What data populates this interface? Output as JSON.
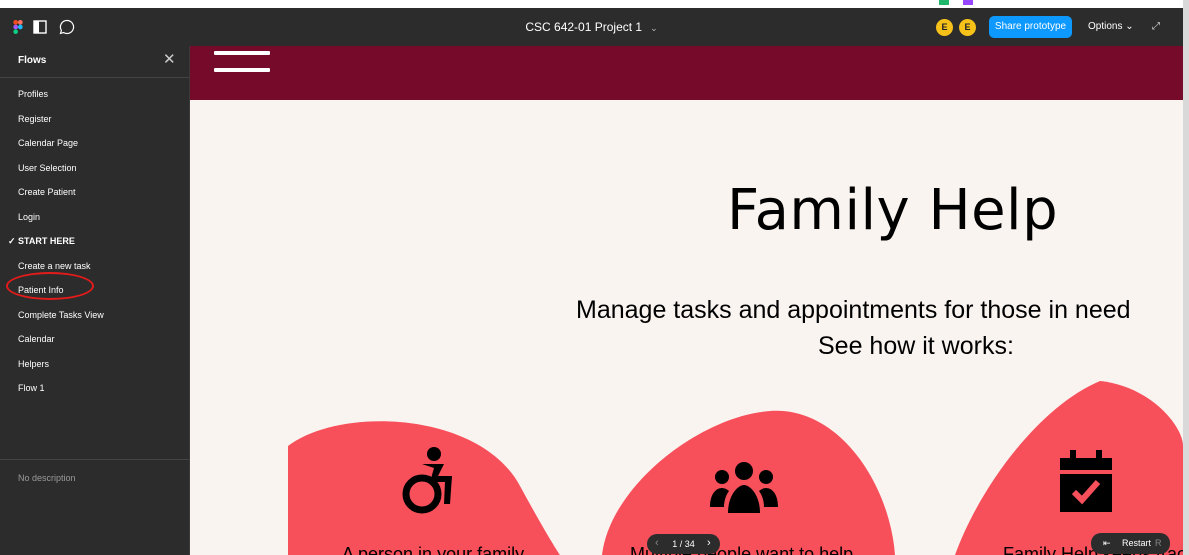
{
  "topbar": {
    "document_title": "CSC 642-01 Project 1",
    "title_chevron": "⌄",
    "avatars": [
      {
        "initial": "E",
        "color": "#f6c21a",
        "dot_color": "#1fb86b"
      },
      {
        "initial": "E",
        "color": "#f6c21a",
        "dot_color": "#9747ff"
      }
    ],
    "share_label": "Share prototype",
    "options_label": "Options ⌄",
    "expand_glyph": "⤢"
  },
  "sidebar": {
    "title": "Flows",
    "close_glyph": "✕",
    "items": [
      {
        "label": "Profiles"
      },
      {
        "label": "Register"
      },
      {
        "label": "Calendar Page"
      },
      {
        "label": "User Selection"
      },
      {
        "label": "Create Patient"
      },
      {
        "label": "Login"
      },
      {
        "label": "START HERE",
        "selected": true
      },
      {
        "label": "Create a new task"
      },
      {
        "label": "Patient Info"
      },
      {
        "label": "Complete Tasks View"
      },
      {
        "label": "Calendar"
      },
      {
        "label": "Helpers"
      },
      {
        "label": "Flow 1"
      }
    ],
    "check_glyph": "✓",
    "description": "No description"
  },
  "prototype": {
    "hero_title": "Family Help",
    "tagline": "Manage tasks and appointments for those in need",
    "sub_tagline": "See how it works:",
    "cards": [
      {
        "icon": "accessible-icon",
        "text": "A person in your family"
      },
      {
        "icon": "users-icon",
        "text": "Multiple people want to help"
      },
      {
        "icon": "calendar-check-icon",
        "text": "Family Help keeps track"
      }
    ],
    "colors": {
      "header": "#760a2a",
      "blob": "#f7505b",
      "background": "#faf4f1"
    }
  },
  "controls": {
    "pager_text": "1 / 34",
    "prev_glyph": "‹",
    "next_glyph": "›",
    "restart_arrow": "⇤",
    "restart_label": "Restart",
    "restart_key": "R"
  }
}
